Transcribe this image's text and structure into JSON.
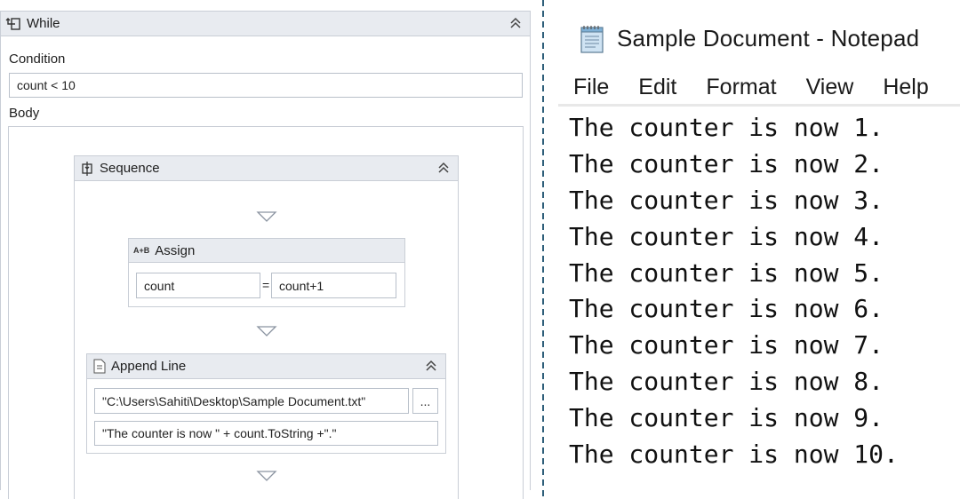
{
  "designer": {
    "while": {
      "title": "While",
      "condition_label": "Condition",
      "condition_value": "count < 10",
      "body_label": "Body"
    },
    "sequence": {
      "title": "Sequence"
    },
    "assign": {
      "title": "Assign",
      "icon_text": "A+B",
      "to_value": "count",
      "equals": "=",
      "value": "count+1"
    },
    "append_line": {
      "title": "Append Line",
      "file_value": "\"C:\\Users\\Sahiti\\Desktop\\Sample Document.txt\"",
      "browse_label": "...",
      "text_value": "\"The counter is now \" + count.ToString +\".\""
    }
  },
  "notepad": {
    "title": "Sample Document - Notepad",
    "menu": [
      "File",
      "Edit",
      "Format",
      "View",
      "Help"
    ],
    "lines": [
      "The counter is now 1.",
      "The counter is now 2.",
      "The counter is now 3.",
      "The counter is now 4.",
      "The counter is now 5.",
      "The counter is now 6.",
      "The counter is now 7.",
      "The counter is now 8.",
      "The counter is now 9.",
      "The counter is now 10."
    ]
  },
  "colors": {
    "header_bg": "#e8ebf0",
    "border": "#c9ced6",
    "divider": "#2f5f7a"
  }
}
